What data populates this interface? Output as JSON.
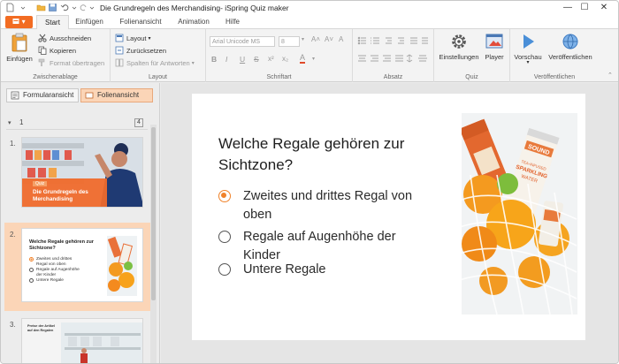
{
  "window": {
    "title": "Die Grundregeln des Merchandising- iSpring Quiz maker",
    "controls": [
      "minimize-icon",
      "maximize-icon",
      "close-icon"
    ]
  },
  "tabs": {
    "file_label": "▾",
    "items": [
      {
        "label": "Start",
        "active": true
      },
      {
        "label": "Einfügen",
        "active": false
      },
      {
        "label": "Folienansicht",
        "active": false
      },
      {
        "label": "Animation",
        "active": false
      },
      {
        "label": "Hilfe",
        "active": false
      }
    ]
  },
  "ribbon": {
    "clipboard": {
      "label": "Zwischenablage",
      "paste": "Einfügen",
      "cut": "Ausschneiden",
      "copy": "Kopieren",
      "format": "Format übertragen"
    },
    "layout": {
      "label": "Layout",
      "layout": "Layout",
      "reset": "Zurücksetzen",
      "columns": "Spalten für Antworten"
    },
    "font": {
      "label": "Schriftart",
      "family": "Arial Unicode MS",
      "size": "8",
      "bold": "B",
      "italic": "I",
      "underline": "U",
      "strike": "S",
      "superscript": "x²",
      "subscript": "x₂",
      "color": "A",
      "grow": "A˄",
      "shrink": "A˅",
      "clear": "A"
    },
    "paragraph": {
      "label": "Absatz"
    },
    "quiz": {
      "label": "Quiz",
      "settings": "Einstellungen",
      "player": "Player"
    },
    "publish": {
      "label": "Veröffentlichen",
      "preview": "Vorschau",
      "publish": "Veröffentlichen"
    }
  },
  "left_panel": {
    "view_tabs": [
      {
        "label": "Formularansicht",
        "active": false
      },
      {
        "label": "Folienansicht",
        "active": true
      }
    ],
    "group": {
      "number": "1",
      "count": "4"
    },
    "slides": [
      {
        "num": "1.",
        "badge": "Quiz",
        "title": "Die Grundregeln des Merchandising"
      },
      {
        "num": "2.",
        "title": "Welche Regale gehören zur Sichtzone?",
        "answers": [
          "Zweites und drittes Regal von oben",
          "Regale auf Augenhöhe der Kinder",
          "Untere Regale"
        ]
      },
      {
        "num": "3.",
        "title": "Preise der Artikel auf den Regalen"
      }
    ]
  },
  "slide": {
    "question": "Welche Regale gehören zur Sichtzone?",
    "answers": [
      {
        "text": "Zweites und drittes Regal von oben",
        "selected": true
      },
      {
        "text": "Regale auf Augenhöhe der Kinder",
        "selected": false
      },
      {
        "text": "Untere Regale",
        "selected": false
      }
    ],
    "image": "net-bag-with-oranges-and-drinks",
    "can_label_1": "SOUND",
    "can_label_2": "TEA-INFUSED SPARKLING WATER"
  },
  "colors": {
    "accent": "#f26c22",
    "selection": "#fbd5b7",
    "radio_on": "#f0822a"
  }
}
